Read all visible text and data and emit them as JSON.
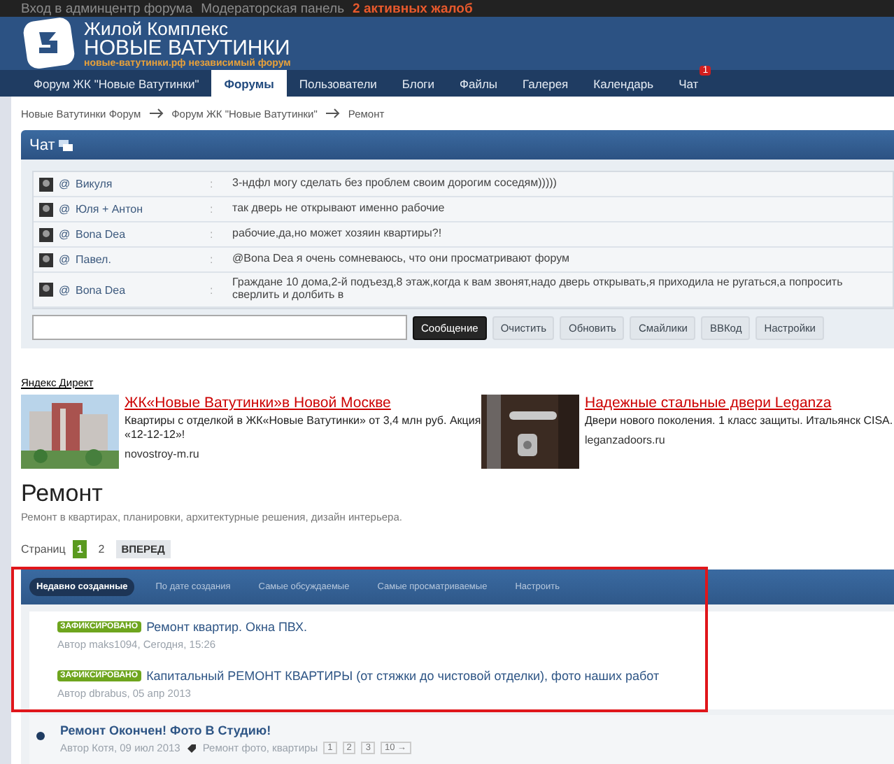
{
  "top_bar": {
    "links": [
      "Вход в админцентр форума",
      "Модераторская панель"
    ],
    "alert": "2 активных жалоб"
  },
  "logo": {
    "line1": "Жилой Комплекс",
    "line2": "НОВЫЕ ВАТУТИНКИ",
    "tagline": "новые-ватутинки.рф независимый форум"
  },
  "nav": [
    {
      "label": "Форум ЖК \"Новые Ватутинки\"",
      "selected": false
    },
    {
      "label": "Форумы",
      "selected": true
    },
    {
      "label": "Пользователи",
      "selected": false
    },
    {
      "label": "Блоги",
      "selected": false
    },
    {
      "label": "Файлы",
      "selected": false
    },
    {
      "label": "Галерея",
      "selected": false
    },
    {
      "label": "Календарь",
      "selected": false
    },
    {
      "label": "Чат",
      "selected": false,
      "badge": "1"
    }
  ],
  "breadcrumb": [
    "Новые Ватутинки Форум",
    "Форум ЖК \"Новые Ватутинки\"",
    "Ремонт"
  ],
  "chat": {
    "title": "Чат",
    "messages": [
      {
        "mention": "@",
        "author": "Викуля",
        "separator": ":",
        "text": "3-ндфл могу сделать без проблем своим дорогим соседям)))))"
      },
      {
        "mention": "@",
        "author": "Юля + Антон",
        "separator": ":",
        "text": "так дверь не открывают именно рабочие"
      },
      {
        "mention": "@",
        "author": "Bona Dea",
        "separator": ":",
        "text": "рабочие,да,но может хозяин квартиры?!"
      },
      {
        "mention": "@",
        "author": "Павел.",
        "separator": ":",
        "text": "@Bona Dea я очень сомневаюсь, что они просматривают форум"
      },
      {
        "mention": "@",
        "author": "Bona Dea",
        "separator": ":",
        "text": "Граждане 10 дома,2-й подъезд,8 этаж,когда к вам звонят,надо дверь открывать,я приходила не ругаться,а попросить сверлить и долбить в"
      }
    ],
    "buttons": [
      {
        "label": "Сообщение",
        "kind": "primary"
      },
      {
        "label": "Очистить",
        "kind": "plain"
      },
      {
        "label": "Обновить",
        "kind": "plain"
      },
      {
        "label": "Смайлики",
        "kind": "plain"
      },
      {
        "label": "BBКод",
        "kind": "plain"
      },
      {
        "label": "Настройки",
        "kind": "plain"
      }
    ]
  },
  "ads": {
    "label": "Яндекс Директ",
    "items": [
      {
        "title": "ЖК«Новые Ватутинки»в Новой Москве",
        "text": "Квартиры с отделкой в ЖК«Новые Ватутинки» от 3,4 млн руб. Акция «12-12-12»!",
        "domain": "novostroy-m.ru",
        "kind": "building"
      },
      {
        "title": "Надежные стальные двери Leganza",
        "text": "Двери нового поколения. 1 класс защиты. Итальянск CISA.",
        "domain": "leganzadoors.ru",
        "kind": "door"
      }
    ]
  },
  "forum": {
    "title": "Ремонт",
    "description": "Ремонт в квартирах, планировки, архитектурные решения, дизайн интерьера."
  },
  "pagination": {
    "label": "Страниц",
    "pages": [
      {
        "label": "1",
        "selected": true
      },
      {
        "label": "2",
        "selected": false
      }
    ],
    "next": "ВПЕРЕД"
  },
  "sort_tabs": [
    {
      "label": "Недавно созданные",
      "selected": true
    },
    {
      "label": "По дате создания",
      "selected": false
    },
    {
      "label": "Самые обсуждаемые",
      "selected": false
    },
    {
      "label": "Самые просматриваемые",
      "selected": false
    },
    {
      "label": "Настроить",
      "selected": false
    }
  ],
  "topics": [
    {
      "pinned": true,
      "tag": "ЗАФИКСИРОВАНО",
      "title": "Ремонт квартир. Окна ПВХ.",
      "meta": "Автор maks1094, Сегодня, 15:26"
    },
    {
      "pinned": true,
      "tag": "ЗАФИКСИРОВАНО",
      "title": "Капитальный РЕМОНТ КВАРТИРЫ (от стяжки до чистовой отделки), фото наших работ",
      "meta": "Автор dbrabus, 05 апр 2013"
    },
    {
      "pinned": false,
      "title": "Ремонт Окончен! Фото В Студию!",
      "meta": "Автор Котя, 09 июл 2013",
      "tags": "Ремонт фото, квартиры",
      "pages": [
        "1",
        "2",
        "3",
        "10 →"
      ]
    }
  ]
}
